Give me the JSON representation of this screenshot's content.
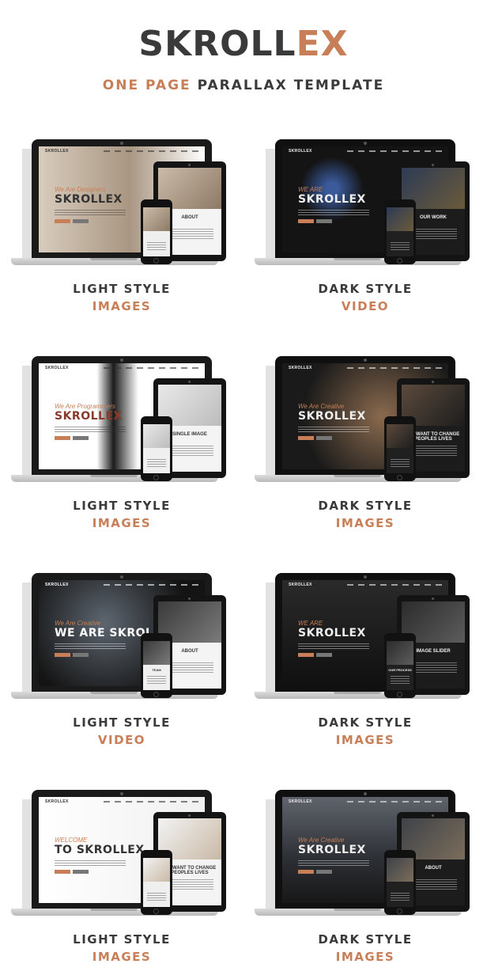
{
  "header": {
    "logo_main": "SKROLL",
    "logo_accent": "EX",
    "tagline_accent": "ONE PAGE",
    "tagline_rest": "PARALLAX TEMPLATE"
  },
  "colors": {
    "accent": "#c87f57",
    "text_dark": "#3a3a3a",
    "background": "#ffffff"
  },
  "previews": [
    {
      "style": "LIGHT STYLE",
      "media": "IMAGES",
      "theme": "light",
      "laptop": {
        "brand": "SKROLLEX",
        "sub": "We Are Designers",
        "title": "SKROLLEX"
      },
      "tablet": {
        "title": "ABOUT"
      },
      "phone": {
        "title": ""
      }
    },
    {
      "style": "DARK STYLE",
      "media": "VIDEO",
      "theme": "dark",
      "laptop": {
        "brand": "SKROLLEX",
        "sub": "WE ARE",
        "title": "SKROLLEX"
      },
      "tablet": {
        "title": "OUR WORK"
      },
      "phone": {
        "title": ""
      }
    },
    {
      "style": "LIGHT STYLE",
      "media": "IMAGES",
      "theme": "light",
      "laptop": {
        "brand": "SKROLLEX",
        "sub": "We Are Programmers",
        "title": "SKROLLEX"
      },
      "tablet": {
        "title": "SINGLE IMAGE"
      },
      "phone": {
        "title": ""
      }
    },
    {
      "style": "DARK STYLE",
      "media": "IMAGES",
      "theme": "dark",
      "laptop": {
        "brand": "SKROLLEX",
        "sub": "We Are Creative",
        "title": "SKROLLEX"
      },
      "tablet": {
        "title": "WE WANT TO CHANGE PEOPLES LIVES"
      },
      "phone": {
        "title": ""
      }
    },
    {
      "style": "LIGHT STYLE",
      "media": "VIDEO",
      "theme": "light",
      "laptop": {
        "brand": "SKROLLEX",
        "sub": "We Are Creative",
        "title": "WE ARE SKROLLEX"
      },
      "tablet": {
        "title": "ABOUT"
      },
      "phone": {
        "title": "TEAM"
      }
    },
    {
      "style": "DARK STYLE",
      "media": "IMAGES",
      "theme": "dark",
      "laptop": {
        "brand": "SKROLLEX",
        "sub": "WE ARE",
        "title": "SKROLLEX"
      },
      "tablet": {
        "title": "IMAGE SLIDER"
      },
      "phone": {
        "title": "OUR PROCESS"
      }
    },
    {
      "style": "LIGHT STYLE",
      "media": "IMAGES",
      "theme": "light",
      "laptop": {
        "brand": "SKROLLEX",
        "sub": "WELCOME",
        "title": "TO SKROLLEX"
      },
      "tablet": {
        "title": "WE WANT TO CHANGE PEOPLES LIVES"
      },
      "phone": {
        "title": ""
      }
    },
    {
      "style": "DARK STYLE",
      "media": "IMAGES",
      "theme": "dark",
      "laptop": {
        "brand": "SKROLLEX",
        "sub": "We Are Creative",
        "title": "SKROLLEX"
      },
      "tablet": {
        "title": "ABOUT"
      },
      "phone": {
        "title": ""
      }
    }
  ]
}
